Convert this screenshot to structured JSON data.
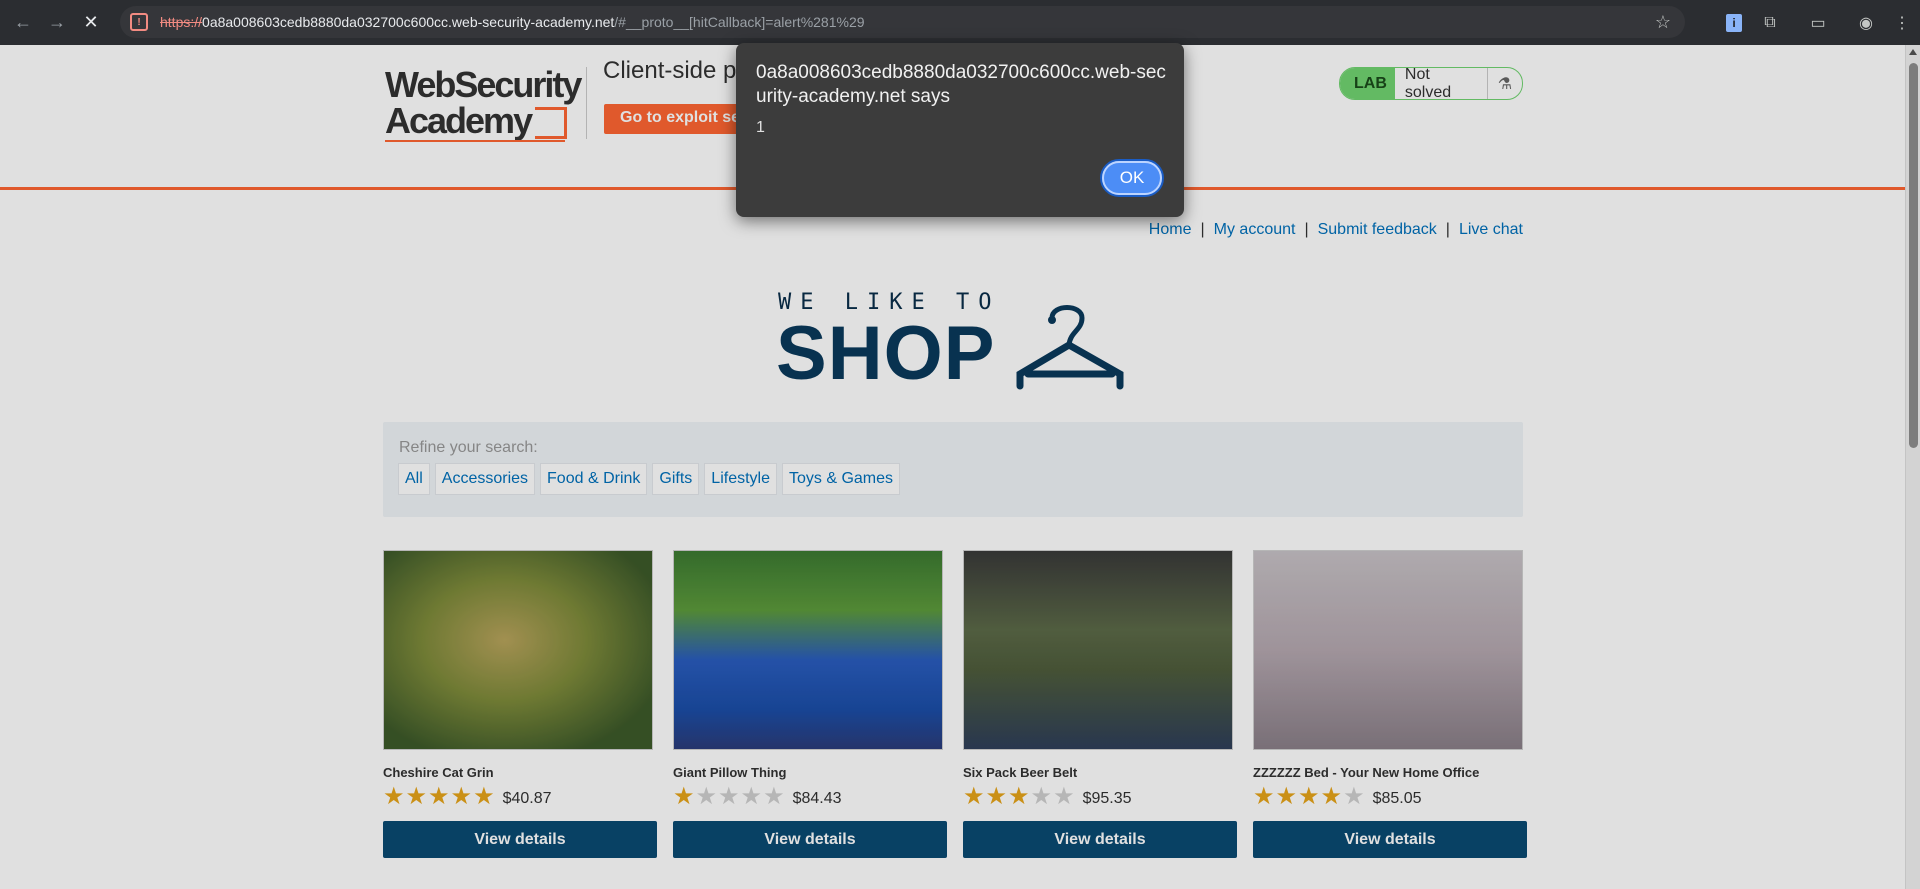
{
  "browser": {
    "url_scheme": "https://",
    "url_host": "0a8a008603cedb8880da032700c600cc.web-security-academy.net",
    "url_path": "/#__proto__[hitCallback]=alert%281%29",
    "site_icon": "warning-icon",
    "icons": [
      "back-arrow-icon",
      "forward-arrow-icon",
      "stop-icon",
      "star-icon",
      "accessibility-extension-icon",
      "extensions-puzzle-icon",
      "media-cast-icon",
      "profile-icon",
      "more-icon"
    ]
  },
  "header": {
    "logo_line1": "WebSecurity",
    "logo_line2": "Academy",
    "lab_title": "Client-side p",
    "exploit_button": "Go to exploit se",
    "lab_badge": "LAB",
    "lab_status": "Not solved"
  },
  "nav": {
    "home": "Home",
    "account": "My account",
    "feedback": "Submit feedback",
    "chat": "Live chat",
    "separator": "|"
  },
  "shop": {
    "tagline": "WE LIKE TO",
    "title": "SHOP"
  },
  "filter": {
    "label": "Refine your search:",
    "categories": [
      "All",
      "Accessories",
      "Food & Drink",
      "Gifts",
      "Lifestyle",
      "Toys & Games"
    ]
  },
  "products": [
    {
      "name": "Cheshire Cat Grin",
      "rating": 5,
      "price": "$40.87",
      "button": "View details"
    },
    {
      "name": "Giant Pillow Thing",
      "rating": 1,
      "price": "$84.43",
      "button": "View details"
    },
    {
      "name": "Six Pack Beer Belt",
      "rating": 3,
      "price": "$95.35",
      "button": "View details"
    },
    {
      "name": "ZZZZZZ Bed - Your New Home Office",
      "rating": 4,
      "price": "$85.05",
      "button": "View details"
    }
  ],
  "dialog": {
    "title": "0a8a008603cedb8880da032700c600cc.web-security-academy.net says",
    "message": "1",
    "ok_label": "OK"
  }
}
